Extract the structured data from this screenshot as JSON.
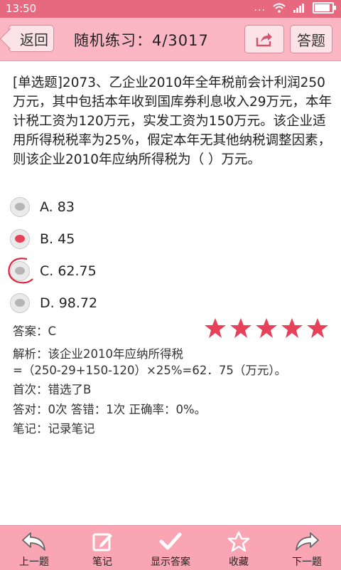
{
  "status_bar": {
    "time": "13:50",
    "signal_dots": "...",
    "icons": [
      "wifi-icon",
      "signal-icon",
      "battery-icon"
    ]
  },
  "header": {
    "back_label": "返回",
    "title": "随机练习：4/3017",
    "share_icon": "share-icon",
    "answer_label": "答题"
  },
  "question": {
    "text": "[单选题]2073、乙企业2010年全年税前会计利润250万元，其中包括本年收到国库券利息收入29万元，本年计税工资为120万元，实发工资为150万元。该企业适用所得税税率为25%，假定本年无其他纳税调整因素，则该企业2010年应纳所得税为（ ）万元。"
  },
  "options": [
    {
      "label": "A. 83",
      "selected": false
    },
    {
      "label": "B. 45",
      "selected": true
    },
    {
      "label": "C. 62.75",
      "selected": false,
      "circled": true
    },
    {
      "label": "D. 98.72",
      "selected": false
    }
  ],
  "answer": {
    "text": "答案：C",
    "stars": 5
  },
  "analysis": {
    "line1": "解析：该企业2010年应纳所得税",
    "line2": "=（250-29+150-120）×25%=62．75（万元）。"
  },
  "first_attempt": "首次：错选了B",
  "stats": "答对：0次  答错：1次 正确率：0%。",
  "notes": "笔记：记录笔记",
  "bottom_bar": [
    {
      "label": "上一题",
      "icon": "prev-arrow-icon"
    },
    {
      "label": "笔记",
      "icon": "edit-icon"
    },
    {
      "label": "显示答案",
      "icon": "check-icon"
    },
    {
      "label": "收藏",
      "icon": "star-outline-icon"
    },
    {
      "label": "下一题",
      "icon": "next-arrow-icon"
    }
  ],
  "colors": {
    "accent": "#e8425b",
    "header_bg": "#fab6c2",
    "status_bg": "#e7697f",
    "star": "#e8425b"
  }
}
